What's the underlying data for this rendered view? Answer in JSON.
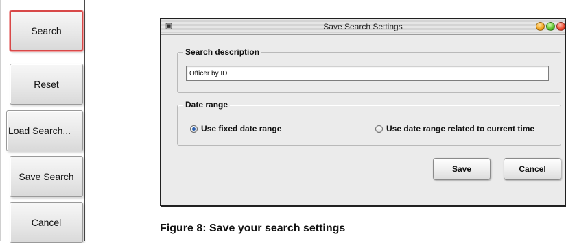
{
  "left_panel": {
    "buttons": [
      {
        "label": "Search"
      },
      {
        "label": "Reset"
      },
      {
        "label": "Load Search..."
      },
      {
        "label": "Save Search"
      },
      {
        "label": "Cancel"
      }
    ]
  },
  "dialog": {
    "title": "Save Search Settings",
    "search_description": {
      "legend": "Search description",
      "value": "Officer by ID"
    },
    "date_range": {
      "legend": "Date range",
      "options": [
        {
          "label": "Use fixed date range",
          "selected": true
        },
        {
          "label": "Use date range related to current time",
          "selected": false
        }
      ]
    },
    "save_label": "Save",
    "cancel_label": "Cancel"
  },
  "caption": "Figure 8: Save your search settings",
  "colors": {
    "active_border": "#d84848",
    "dialog_bg": "#ebebeb",
    "radio_selected": "#2a5fb0"
  }
}
